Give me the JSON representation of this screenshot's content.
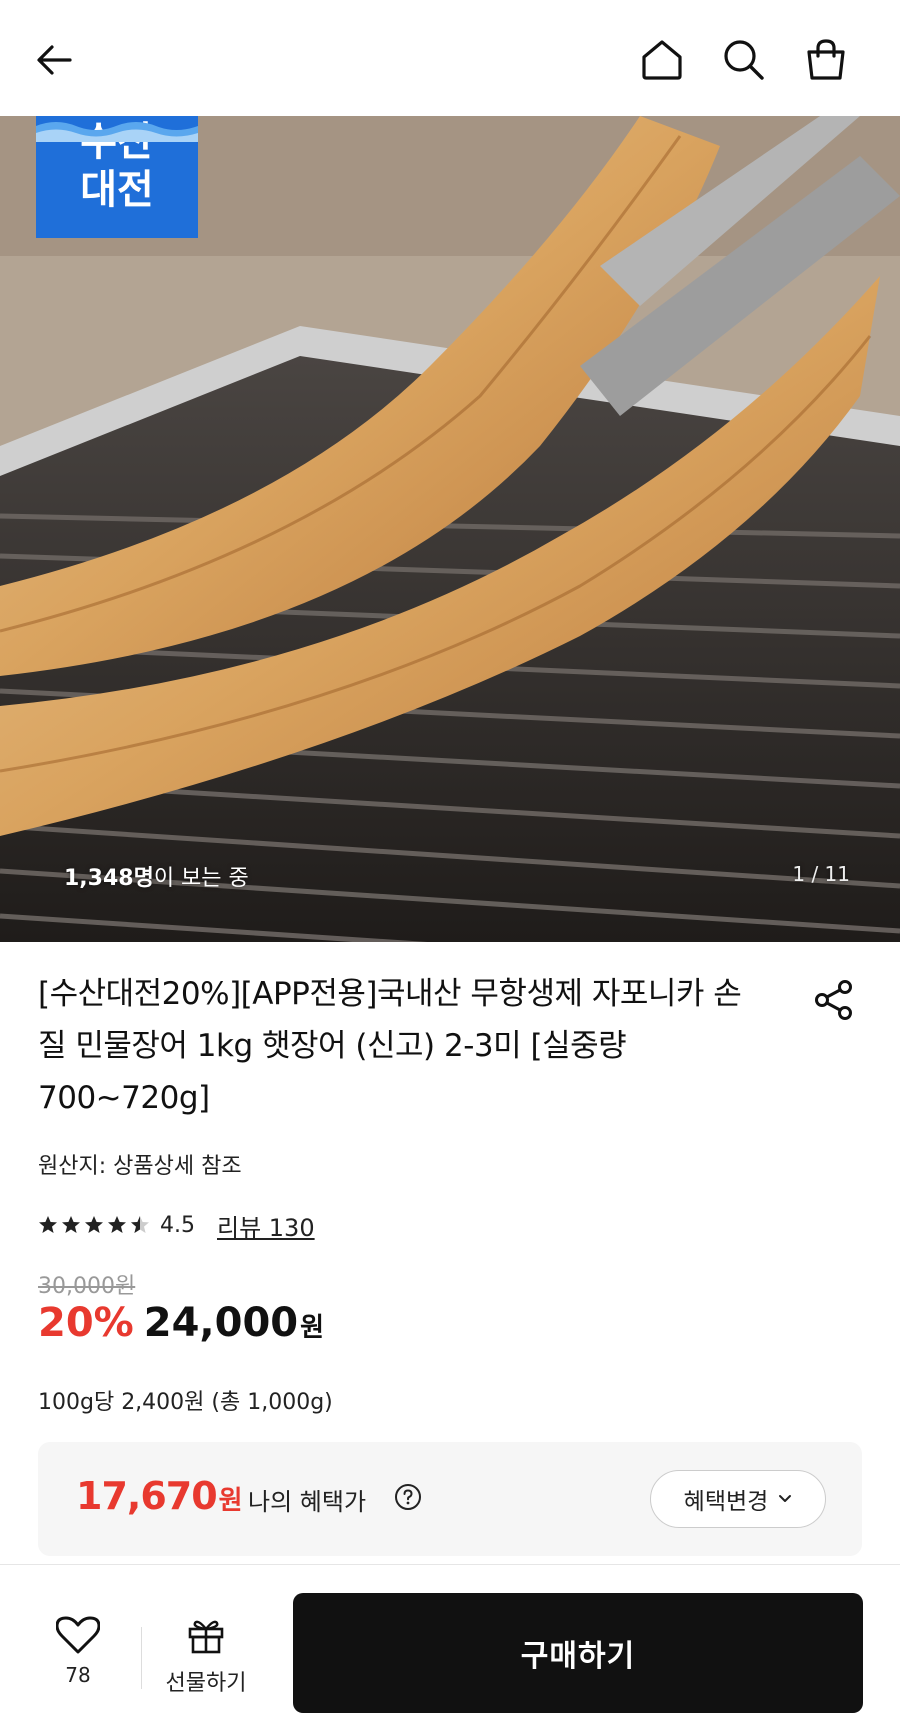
{
  "header": {
    "back_icon": "arrow-left-icon",
    "home_icon": "home-icon",
    "search_icon": "search-icon",
    "cart_icon": "shopping-bag-icon"
  },
  "hero": {
    "badge_line1": "수산",
    "badge_line2": "대전",
    "viewers_count": "1,348명",
    "viewers_suffix": "이 보는 중",
    "page_indicator": "1 / 11"
  },
  "product": {
    "title": "[수산대전20%][APP전용]국내산 무항생제 자포니카 손질 민물장어 1kg 햇장어 (신고) 2-3미 [실중량 700~720g]",
    "origin": "원산지: 상품상세 참조",
    "rating": "4.5",
    "rating_stars": 4.5,
    "review_link": "리뷰 130",
    "original_price": "30,000원",
    "discount": "20%",
    "price": "24,000",
    "price_unit": "원",
    "unit_price": "100g당 2,400원 (총 1,000g)"
  },
  "benefit": {
    "price": "17,670",
    "price_unit": "원",
    "label": "나의 혜택가",
    "change_button": "혜택변경"
  },
  "bottom_bar": {
    "wish_count": "78",
    "gift_label": "선물하기",
    "buy_label": "구매하기"
  },
  "colors": {
    "accent_red": "#e8392f",
    "badge_blue": "#1f6fd9",
    "buy_button": "#111111"
  }
}
